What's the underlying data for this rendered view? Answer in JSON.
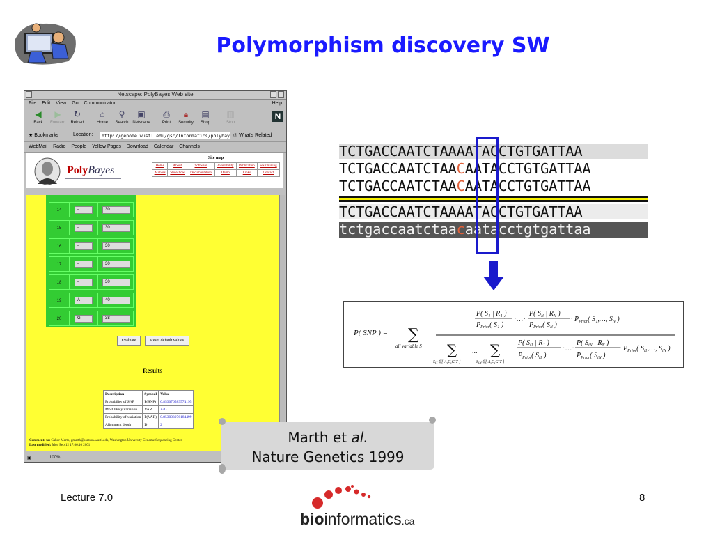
{
  "slide": {
    "title": "Polymorphism discovery SW",
    "footer_left": "Lecture 7.0",
    "page_number": "8"
  },
  "browser": {
    "window_title": "Netscape: PolyBayes Web site",
    "menu": [
      "File",
      "Edit",
      "View",
      "Go",
      "Communicator"
    ],
    "menu_help": "Help",
    "toolbar": [
      "Back",
      "Forward",
      "Reload",
      "Home",
      "Search",
      "Netscape",
      "Print",
      "Security",
      "Shop",
      "Stop"
    ],
    "bookmarks_label": "Bookmarks",
    "location_label": "Location:",
    "url": "http://genome.wustl.edu/gsc/Informatics/polybayes",
    "whats_related": "What's Related",
    "personal_toolbar": [
      "WebMail",
      "Radio",
      "People",
      "Yellow Pages",
      "Download",
      "Calendar",
      "Channels"
    ],
    "status_zoom": "100%"
  },
  "page": {
    "logo_text_poly": "Poly",
    "logo_text_bayes": "Bayes",
    "sitemap_title": "Site map",
    "sitemap_row1": [
      "Home",
      "About",
      "Software",
      "Availability",
      "Publication",
      "SNP mining"
    ],
    "sitemap_row2": [
      "Authors",
      "Slideshow",
      "Documentation",
      "Demo",
      "Links",
      "Contact"
    ],
    "rows": [
      {
        "num": "14",
        "base": "-",
        "depth": "30"
      },
      {
        "num": "15",
        "base": "-",
        "depth": "30"
      },
      {
        "num": "16",
        "base": "-",
        "depth": "30"
      },
      {
        "num": "17",
        "base": "-",
        "depth": "30"
      },
      {
        "num": "18",
        "base": "-",
        "depth": "30"
      },
      {
        "num": "19",
        "base": "A",
        "depth": "40"
      },
      {
        "num": "20",
        "base": "G",
        "depth": "38"
      }
    ],
    "evaluate_label": "Evaluate",
    "reset_label": "Reset default values",
    "results_title": "Results",
    "results_headers": [
      "Description",
      "Symbol",
      "Value"
    ],
    "results_rows": [
      [
        "Probability of SNP",
        "P(SNP)",
        "0.853076589574195"
      ],
      [
        "Most likely variation",
        "VAR",
        "A/G"
      ],
      [
        "Probability of variation",
        "P(VAR)",
        "0.853003076184499"
      ],
      [
        "Alignment depth",
        "D",
        "2"
      ]
    ],
    "comments_label": "Comments to:",
    "comments_text": "Gabor Marth, gmarth@watson.wustl.edu, Washington University Genome Sequencing Center",
    "modified_label": "Last modified:",
    "modified_text": "Mon Feb 12 17:06:10 2001"
  },
  "alignment": {
    "rows": [
      {
        "pre": "TCTGACCAATCTA",
        "mid": "AAA",
        "post": "TACCTGTGATTAA",
        "style": "gray"
      },
      {
        "pre": "TCTGACCAATCTA",
        "mid": "ACA",
        "post": "ATACCTGTGATTAA",
        "style": "snp"
      },
      {
        "pre": "TCTGACCAATCTA",
        "mid": "ACA",
        "post": "ATACCTGTGATTAA",
        "style": "snp"
      },
      {
        "pre": "TCTGACCAATCTA",
        "mid": "AAA",
        "post": "TACCTGTGATTAA",
        "style": "gray"
      },
      {
        "pre": "tctgaccaatcta",
        "mid": "aca",
        "post": "atacctgtgattaa",
        "style": "dark"
      }
    ],
    "snp_color": "#e0603a",
    "box_color": "#1a1acc"
  },
  "formula": {
    "lhs": "P( SNP ) =",
    "sum_sub": "all   variable   S",
    "num_top": "P( S₁ | R₁ ) / P_Prior( S₁ ) · … · P( S_N | R_N ) / P_Prior( S_N ) · P_Prior( S₁,…, S_N )",
    "den_sum1": "S_i1 ∈{ A,C,G,T }",
    "den_sum2": "S_iN ∈{ A,C,G,T }",
    "den_expr": "P( S_i1 | R₁ ) / P_Prior( S_i1 ) · … · P( S_iN | R_N ) / P_Prior( S_iN ) · P_Prior( S_i1,…, S_iN )"
  },
  "citation": {
    "author": "Marth et",
    "al": "al.",
    "journal": "Nature Genetics 1999"
  },
  "logo": {
    "bio": "bio",
    "informatics": "informatics",
    "ca": ".ca"
  }
}
